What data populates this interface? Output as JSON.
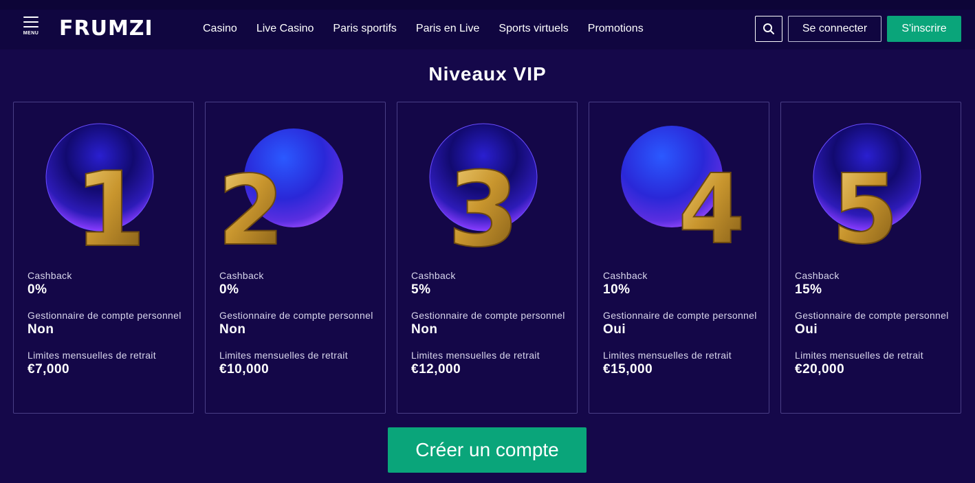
{
  "header": {
    "menu_label": "MENU",
    "logo_text": "FRUMZI",
    "nav": [
      "Casino",
      "Live Casino",
      "Paris sportifs",
      "Paris en Live",
      "Sports virtuels",
      "Promotions"
    ],
    "login_label": "Se connecter",
    "signup_label": "S'inscrire",
    "search_icon": "search-icon"
  },
  "page_title": "Niveaux VIP",
  "levels": [
    {
      "number": "1",
      "cashback_label": "Cashback",
      "cashback": "0%",
      "manager_label": "Gestionnaire de compte personnel",
      "manager": "Non",
      "limit_label": "Limites mensuelles de retrait",
      "limit": "€7,000"
    },
    {
      "number": "2",
      "cashback_label": "Cashback",
      "cashback": "0%",
      "manager_label": "Gestionnaire de compte personnel",
      "manager": "Non",
      "limit_label": "Limites mensuelles de retrait",
      "limit": "€10,000"
    },
    {
      "number": "3",
      "cashback_label": "Cashback",
      "cashback": "5%",
      "manager_label": "Gestionnaire de compte personnel",
      "manager": "Non",
      "limit_label": "Limites mensuelles de retrait",
      "limit": "€12,000"
    },
    {
      "number": "4",
      "cashback_label": "Cashback",
      "cashback": "10%",
      "manager_label": "Gestionnaire de compte personnel",
      "manager": "Oui",
      "limit_label": "Limites mensuelles de retrait",
      "limit": "€15,000"
    },
    {
      "number": "5",
      "cashback_label": "Cashback",
      "cashback": "15%",
      "manager_label": "Gestionnaire de compte personnel",
      "manager": "Oui",
      "limit_label": "Limites mensuelles de retrait",
      "limit": "€20,000"
    }
  ],
  "cta_label": "Créer un compte",
  "colors": {
    "background": "#15084a",
    "accent_green": "#0aa57a",
    "logo_blue": "#4f6bff",
    "gold": "#c9962e"
  }
}
